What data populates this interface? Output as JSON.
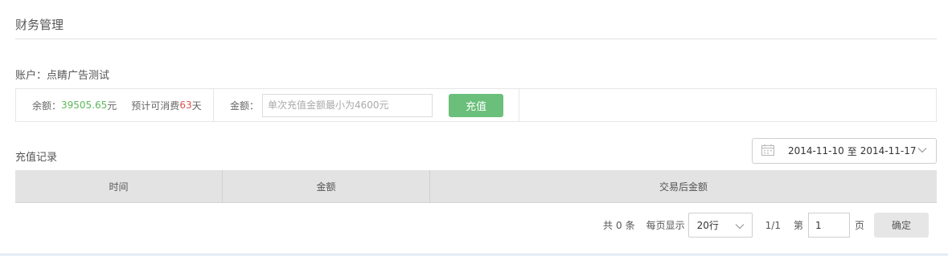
{
  "page": {
    "title": "财务管理"
  },
  "account": {
    "label": "账户：",
    "name": "点睛广告测试",
    "balance_label": "余额：",
    "balance_value": "39505.65",
    "balance_unit": "元",
    "estimate_prefix": "预计可消费",
    "estimate_days": "63",
    "estimate_unit": "天",
    "amount_label": "金额：",
    "amount_value": "",
    "amount_placeholder": "单次充值金额最小为4600元",
    "recharge_button": "充值"
  },
  "records": {
    "title": "充值记录",
    "date_from": "2014-11-10",
    "date_sep": "至",
    "date_to": "2014-11-17",
    "columns": [
      "时间",
      "金额",
      "交易后金额"
    ],
    "rows": []
  },
  "pagination": {
    "total_prefix": "共",
    "total_count": "0",
    "total_unit": "条",
    "per_page_label": "每页显示",
    "per_page_value": "20行",
    "page_status": "1/1",
    "goto_prefix": "第",
    "goto_value": "1",
    "goto_suffix": "页",
    "confirm_button": "确定"
  },
  "colors": {
    "accent_green": "#6abf7a",
    "balance_green": "#5cb85c",
    "days_red": "#d9534f",
    "table_header_bg": "#e3e3e3"
  },
  "icons": {
    "date_picker": "calendar-icon",
    "date_dropdown": "chevron-down-icon",
    "page_size_dropdown": "chevron-down-icon"
  }
}
